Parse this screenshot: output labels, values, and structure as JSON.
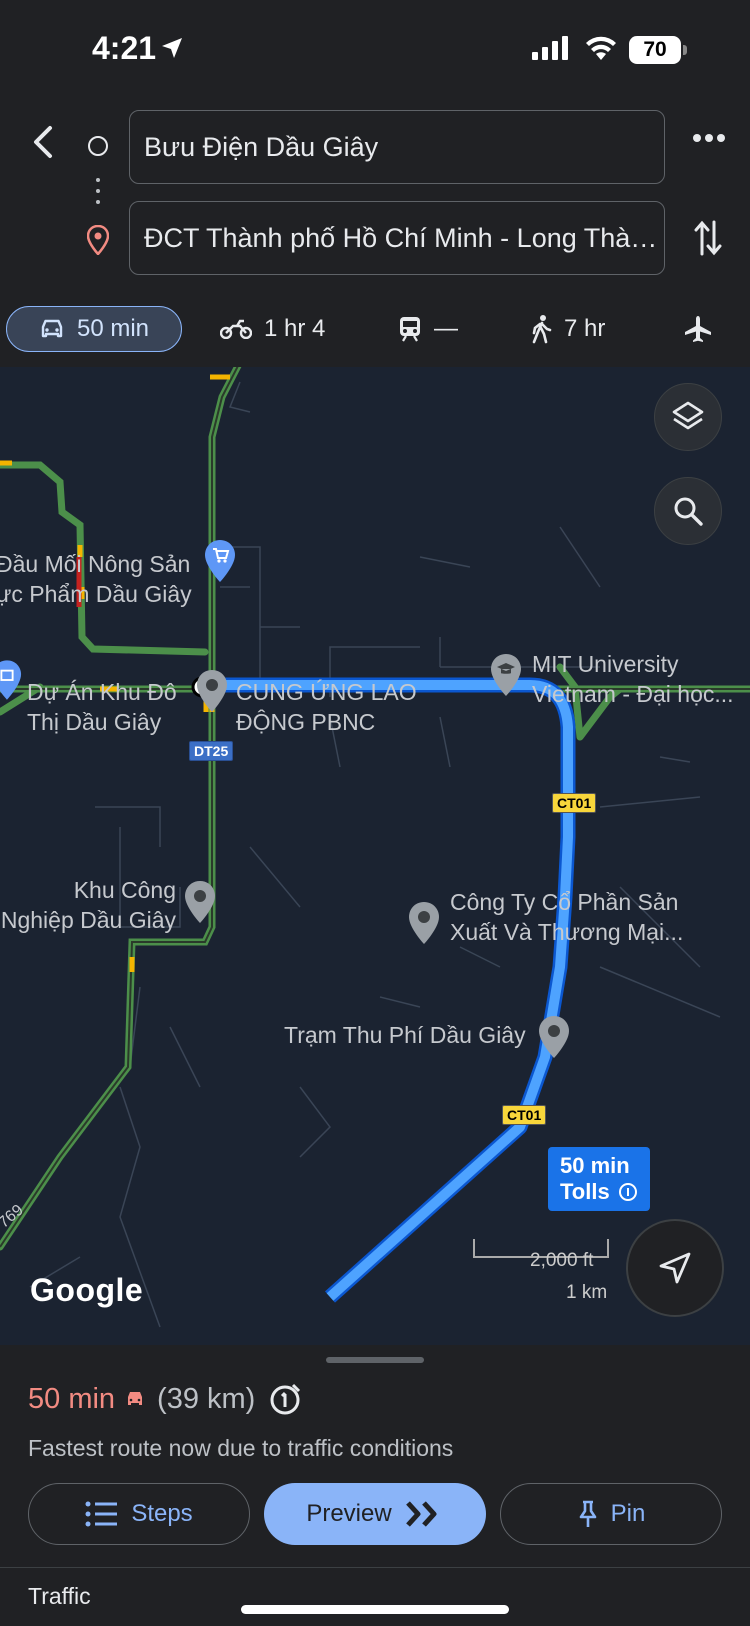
{
  "status": {
    "time": "4:21",
    "battery": "70"
  },
  "search": {
    "origin": "Bưu Điện Dầu Giây",
    "destination": "ĐCT Thành phố Hồ Chí Minh - Long Thành - Dầu Giây"
  },
  "modes": [
    {
      "icon": "car-icon",
      "label": "50 min",
      "active": true
    },
    {
      "icon": "motorcycle-icon",
      "label": "1 hr 4"
    },
    {
      "icon": "train-icon",
      "label": "—"
    },
    {
      "icon": "walk-icon",
      "label": "7 hr"
    },
    {
      "icon": "plane-icon",
      "label": ""
    }
  ],
  "map": {
    "labels": {
      "market": [
        "Đầu Mối Nông Sản",
        "ực Phẩm Dầu Giây"
      ],
      "urban": [
        "Dự Án Khu Đô",
        "Thị Dầu Giây"
      ],
      "company": [
        "CUNG ỨNG LAO",
        "ĐỘNG PBNC"
      ],
      "university": [
        "MIT University",
        "Vietnam - Đại học..."
      ],
      "industrial": [
        "Khu Công",
        "Nghiệp Dầu Giây"
      ],
      "corp": [
        "Công Ty Cổ Phần Sản",
        "Xuất Và Thương Mại..."
      ],
      "toll": "Trạm Thu Phí Dầu Giây"
    },
    "shields": {
      "dt25": "DT25",
      "ct01_a": "CT01",
      "ct01_b": "CT01",
      "side": "769"
    },
    "eta_badge": {
      "time": "50 min",
      "tolls": "Tolls"
    },
    "scale": {
      "ft": "2,000 ft",
      "km": "1 km"
    },
    "attribution": "Google"
  },
  "sheet": {
    "duration": "50 min",
    "distance": "(39 km)",
    "description": "Fastest route now due to traffic conditions",
    "steps_label": "Steps",
    "preview_label": "Preview",
    "pin_label": "Pin",
    "traffic_label": "Traffic"
  },
  "colors": {
    "route": "#4ea3ff",
    "accent": "#8ab4f8",
    "duration": "#f28b82"
  }
}
